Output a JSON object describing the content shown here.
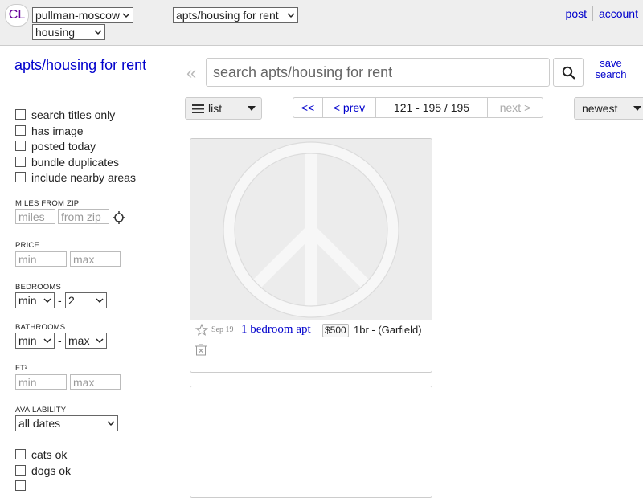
{
  "header": {
    "logo": "CL",
    "location": "pullman-moscow",
    "section": "housing",
    "category": "apts/housing for rent",
    "post": "post",
    "account": "account"
  },
  "sidebar": {
    "title": "apts/housing for rent",
    "checkboxes": [
      "search titles only",
      "has image",
      "posted today",
      "bundle duplicates",
      "include nearby areas"
    ],
    "miles_from_zip": {
      "label": "MILES FROM ZIP",
      "miles_placeholder": "miles",
      "zip_placeholder": "from zip"
    },
    "price": {
      "label": "PRICE",
      "min": "min",
      "max": "max"
    },
    "bedrooms": {
      "label": "BEDROOMS",
      "min": "min",
      "max": "2"
    },
    "bathrooms": {
      "label": "BATHROOMS",
      "min": "min",
      "max": "max"
    },
    "sqft": {
      "label": "FT²",
      "min": "min",
      "max": "max"
    },
    "availability": {
      "label": "AVAILABILITY",
      "value": "all dates"
    },
    "pets": [
      "cats ok",
      "dogs ok"
    ],
    "range_dash": "-"
  },
  "search": {
    "back": "«",
    "placeholder": "search apts/housing for rent",
    "save_line1": "save",
    "save_line2": "search"
  },
  "controls": {
    "view": "list",
    "first": "<<",
    "prev": "< prev",
    "range": "121 - 195 / 195",
    "next": "next >",
    "sort": "newest"
  },
  "results": [
    {
      "date": "Sep 19",
      "title": "1 bedroom apt",
      "price": "$500",
      "details": "1br - (Garfield)"
    }
  ]
}
